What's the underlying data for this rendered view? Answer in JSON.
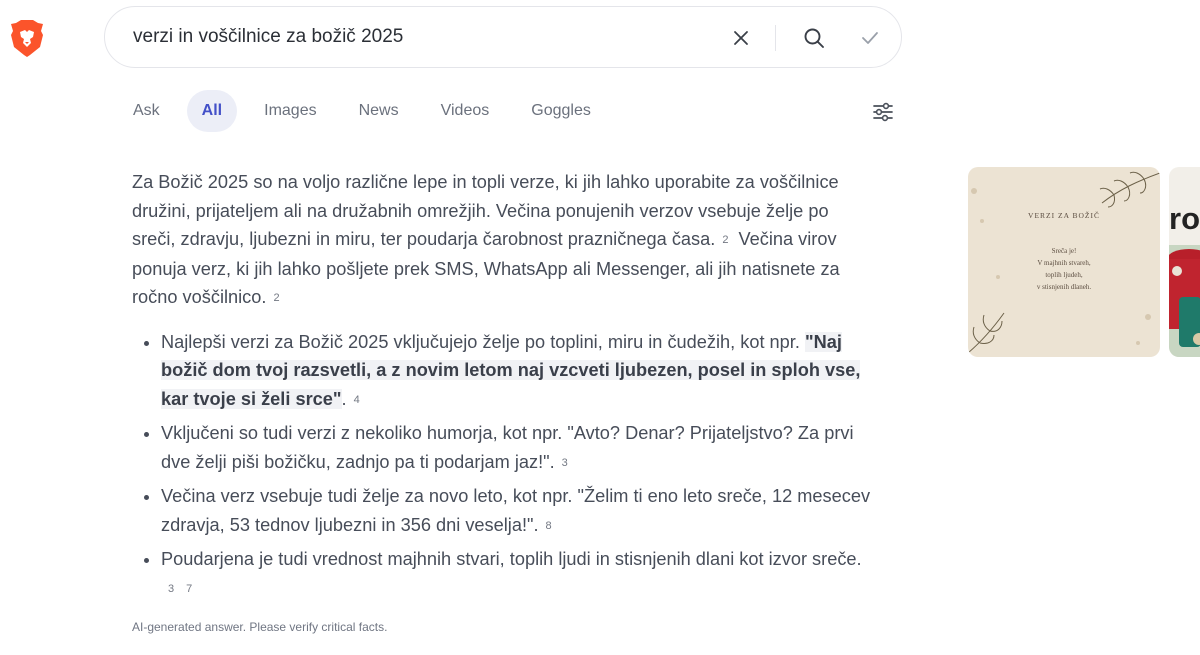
{
  "search": {
    "query": "verzi in voščilnice za božič 2025"
  },
  "tabs": [
    {
      "label": "Ask"
    },
    {
      "label": "All",
      "active": true
    },
    {
      "label": "Images"
    },
    {
      "label": "News"
    },
    {
      "label": "Videos"
    },
    {
      "label": "Goggles"
    }
  ],
  "answer": {
    "intro_1": "Za Božič 2025 so na voljo različne lepe in topli verze, ki jih lahko uporabite za voščilnice družini, prijateljem ali na družabnih omrežjih. Večina ponujenih verzov vsebuje želje po sreči, zdravju, ljubezni in miru, ter poudarja čarobnost prazničnega časa.",
    "intro_1_cite": "2",
    "intro_2": "Večina virov ponuja verz, ki jih lahko pošljete prek SMS, WhatsApp ali Messenger, ali jih natisnete za ročno voščilnico.",
    "intro_2_cite": "2",
    "bullets": [
      {
        "before": "Najlepši verzi za Božič 2025 vključujejo želje po toplini, miru in čudežih, kot npr. ",
        "quote": "\"Naj božič dom tvoj razsvetli, a z novim letom naj vzcveti ljubezen, posel in sploh vse, kar tvoje si želi srce\"",
        "after": ".",
        "cites": [
          "4"
        ]
      },
      {
        "text": "Vključeni so tudi verzi z nekoliko humorja, kot npr. \"Avto? Denar? Prijateljstvo? Za prvi dve želji piši božičku, zadnjo pa ti podarjam jaz!\".",
        "cites": [
          "3"
        ]
      },
      {
        "text": "Večina verz vsebuje tudi želje za novo leto, kot npr. \"Želim ti eno leto sreče, 12 mesecev zdravja, 53 tednov ljubezni in 356 dni veselja!\".",
        "cites": [
          "8"
        ]
      },
      {
        "text": "Poudarjena je tudi vrednost majhnih stvari, toplih ljudi in stisnjenih dlani kot izvor sreče.",
        "cites": [
          "3",
          "7"
        ]
      }
    ],
    "disclaimer": "AI-generated answer. Please verify critical facts."
  },
  "images": {
    "card1": {
      "title": "VERZI ZA BOŽIČ",
      "lines": [
        "Sreča je!",
        "V majhnih stvareh,",
        "toplih ljudeh,",
        "v stisnjenih dlaneh."
      ]
    },
    "card2": {
      "text": "ro"
    }
  },
  "colors": {
    "brand": "#fb542b",
    "accent_tab": "#4350c8",
    "tab_active_bg": "#eceef7",
    "text": "#474d59"
  }
}
